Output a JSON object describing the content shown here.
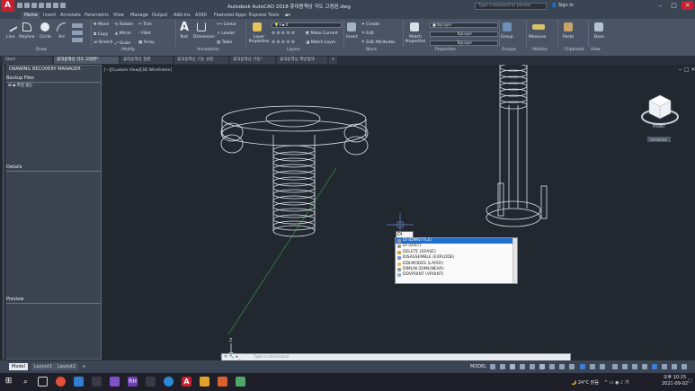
{
  "title_bar": {
    "app_logo": "A",
    "window_title": "Autodesk AutoCAD 2018   휴대용책상 각도 고정판.dwg",
    "search_placeholder": "Type a keyword or phrase",
    "sign_in": "Sign In",
    "minimize": "–",
    "maximize": "□",
    "close": "✕"
  },
  "ribbon_tabs": [
    "Home",
    "Insert",
    "Annotate",
    "Parametric",
    "View",
    "Manage",
    "Output",
    "Add-ins",
    "A360",
    "Featured Apps",
    "Express Tools"
  ],
  "ribbon": {
    "draw": {
      "label": "Draw",
      "line": "Line",
      "polyline": "Polyline",
      "circle": "Circle",
      "arc": "Arc"
    },
    "modify": {
      "label": "Modify",
      "move": "Move",
      "rotate": "Rotate",
      "trim": "Trim",
      "copy": "Copy",
      "mirror": "Mirror",
      "fillet": "Fillet",
      "stretch": "Stretch",
      "scale": "Scale",
      "array": "Array"
    },
    "annotation": {
      "label": "Annotation",
      "text": "Text",
      "dimension": "Dimension",
      "linear": "Linear",
      "leader": "Leader",
      "table": "Table"
    },
    "layers": {
      "label": "Layers",
      "layer_properties": "Layer Properties",
      "layer_value": "0",
      "make_current": "Make Current",
      "match_layer": "Match Layer"
    },
    "block": {
      "label": "Block",
      "insert": "Insert",
      "create": "Create",
      "edit": "Edit",
      "edit_attributes": "Edit Attributes"
    },
    "properties": {
      "label": "Properties",
      "match_properties": "Match Properties",
      "bylayer1": "ByLayer",
      "bylayer2": "ByLayer",
      "bylayer3": "ByLayer"
    },
    "groups": {
      "label": "Groups",
      "group": "Group"
    },
    "utilities": {
      "label": "Utilities",
      "measure": "Measure"
    },
    "clipboard": {
      "label": "Clipboard",
      "paste": "Paste"
    },
    "view": {
      "label": "View",
      "base": "Base"
    }
  },
  "doc_tabs": [
    "Start",
    "휴대용책상 각도 고정판*",
    "휴대용책상 접판",
    "휴대용책상 기둥 설정",
    "휴대용책상 기둥*",
    "휴대용책상 책받침대"
  ],
  "recovery": {
    "title": "DRAWING RECOVERY MANAGER",
    "backup_files": "Backup Files",
    "item": "파일 없는",
    "details": "Details",
    "preview": "Preview"
  },
  "viewport": {
    "label": "[−][Custom View][3D Wireframe]",
    "viewcube": "FRONT",
    "viewcube_wcs": "Unnamed",
    "ucs_z": "Z",
    "ucs_x": "X",
    "ucs_y": "Y"
  },
  "command": {
    "typed": "DI",
    "placeholder": "Type a command",
    "suggestions": [
      "DI (DIMSTYLE)",
      "DI (DIST)",
      "DELETE (ERASE)",
      "DISASSEMBLE (EXPLODE)",
      "DDLMODES (LAYER)",
      "DIMLIN (DIMLINEAR)",
      "DDVPOINT (VPOINT)"
    ],
    "selected_index": 0
  },
  "layout_tabs": [
    "Model",
    "Layout1",
    "Layout2"
  ],
  "add_tab": "+",
  "status": {
    "model": "MODEL"
  },
  "taskbar": {
    "weather": "24°C 맑음",
    "time": "오후 10:15",
    "date": "2021-09-02"
  },
  "colors": {
    "accent": "#1f6fd0",
    "app_red": "#c8202e"
  }
}
